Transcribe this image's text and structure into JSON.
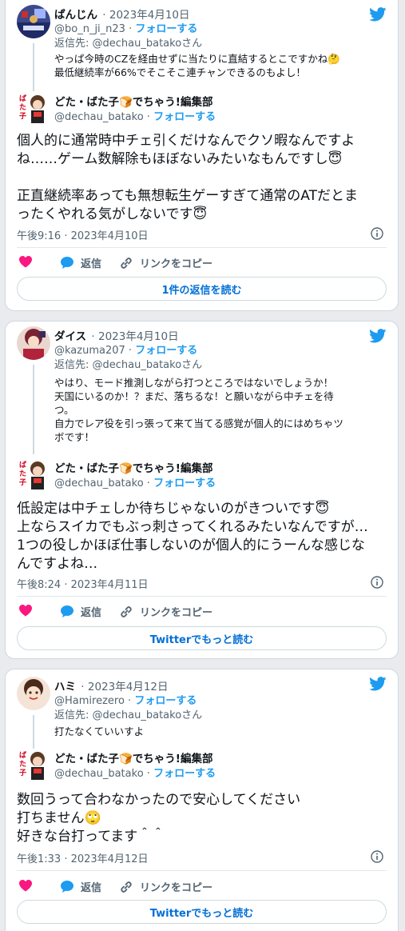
{
  "tweets": [
    {
      "reply": {
        "name": "ぱんじん",
        "date": "· 2023年4月10日",
        "handle": "@bo_n_ji_n23",
        "follow": "フォローする",
        "reply_to": "返信先: @dechau_batakoさん",
        "lines": [
          "やっぱ今時のCZを経由せずに当たりに直結するとこですかね🤔",
          "最低継続率が66%でそこそこ連チャンできるのもよし！"
        ]
      },
      "main": {
        "name": "どた・ばた子🍞でちゃう!編集部",
        "handle": "@dechau_batako",
        "follow": "フォローする",
        "lines": [
          "個人的に通常時中チェ引くだけなんでクソ暇なんですよ",
          "ね……ゲーム数解除もほぼないみたいなもんですし😇",
          "",
          "正直継続率あっても無想転生ゲーすぎて通常のATだとま",
          "ったくやれる気がしないです😇"
        ],
        "time": "午後9:16 · 2023年4月10日"
      },
      "actions": {
        "reply": "返信",
        "copy": "リンクをコピー"
      },
      "button": "1件の返信を読む"
    },
    {
      "reply": {
        "name": "ダイス",
        "date": "· 2023年4月10日",
        "handle": "@kazuma207",
        "follow": "フォローする",
        "reply_to": "返信先: @dechau_batakoさん",
        "lines": [
          "やはり、モード推測しながら打つところではないでしょうか！",
          "天国にいるのか！？まだ、落ちるな！と願いながら中チェを待",
          "つ。",
          "自力でレア役を引っ張って来て当てる感覚が個人的にはめちゃツ",
          "ボです！"
        ]
      },
      "main": {
        "name": "どた・ばた子🍞でちゃう!編集部",
        "handle": "@dechau_batako",
        "follow": "フォローする",
        "lines": [
          "低設定は中チェしか待ちじゃないのがきついです😇",
          "上ならスイカでもぶっ刺さってくれるみたいなんですが…",
          "1つの役しかほぼ仕事しないのが個人的にうーんな感じな",
          "んですよね…"
        ],
        "time": "午後8:24 · 2023年4月11日"
      },
      "actions": {
        "reply": "返信",
        "copy": "リンクをコピー"
      },
      "button": "Twitterでもっと読む"
    },
    {
      "reply": {
        "name": "ハミ",
        "date": "· 2023年4月12日",
        "handle": "@Hamirezero",
        "follow": "フォローする",
        "reply_to": "返信先: @dechau_batakoさん",
        "lines": [
          "打たなくていいすよ"
        ]
      },
      "main": {
        "name": "どた・ばた子🍞でちゃう!編集部",
        "handle": "@dechau_batako",
        "follow": "フォローする",
        "lines": [
          "数回うって合わなかったので安心してください",
          "打ちません🙄",
          "好きな台打ってます＾＾"
        ],
        "time": "午後1:33 · 2023年4月12日"
      },
      "actions": {
        "reply": "返信",
        "copy": "リンクをコピー"
      },
      "button": "Twitterでもっと読む"
    }
  ],
  "colors": {
    "accent": "#1d9bf0",
    "heart": "#f91880",
    "link": "#006fd6"
  },
  "icons": [
    "twitter-bird-icon",
    "heart-icon",
    "reply-bubble-icon",
    "link-icon",
    "info-icon"
  ]
}
